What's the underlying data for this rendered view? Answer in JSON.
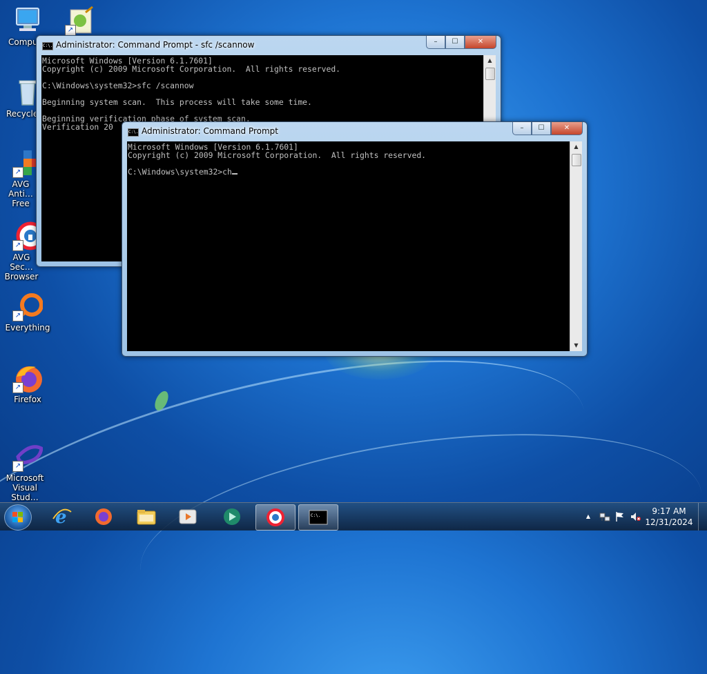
{
  "desktop": {
    "icons": [
      {
        "label": "Compu",
        "name": "computer"
      },
      {
        "label": "",
        "name": "notepad-plus"
      },
      {
        "label": "Recycle",
        "name": "recycle-bin"
      },
      {
        "label": "AVG Anti… Free",
        "name": "avg-antivirus"
      },
      {
        "label": "AVG Sec… Browser",
        "name": "avg-secure-browser"
      },
      {
        "label": "Everything",
        "name": "everything"
      },
      {
        "label": "Firefox",
        "name": "firefox"
      },
      {
        "label": "Microsoft Visual Stud…",
        "name": "visual-studio"
      }
    ]
  },
  "window_back": {
    "title": "Administrator: Command Prompt - sfc  /scannow",
    "console": "Microsoft Windows [Version 6.1.7601]\nCopyright (c) 2009 Microsoft Corporation.  All rights reserved.\n\nC:\\Windows\\system32>sfc /scannow\n\nBeginning system scan.  This process will take some time.\n\nBeginning verification phase of system scan.\nVerification 20"
  },
  "window_front": {
    "title": "Administrator: Command Prompt",
    "console": "Microsoft Windows [Version 6.1.7601]\nCopyright (c) 2009 Microsoft Corporation.  All rights reserved.\n\nC:\\Windows\\system32>ch"
  },
  "controls": {
    "minimize": "–",
    "maximize": "☐",
    "close": "✕"
  },
  "icon_text": {
    "cmd": "C:\\."
  },
  "taskbar": {
    "buttons": [
      "start",
      "internet-explorer",
      "firefox",
      "file-explorer",
      "media-player",
      "browser-app",
      "avg-secure-browser",
      "command-prompt"
    ],
    "tray": {
      "show_hidden": "▲",
      "time": "9:17 AM",
      "date": "12/31/2024"
    }
  }
}
